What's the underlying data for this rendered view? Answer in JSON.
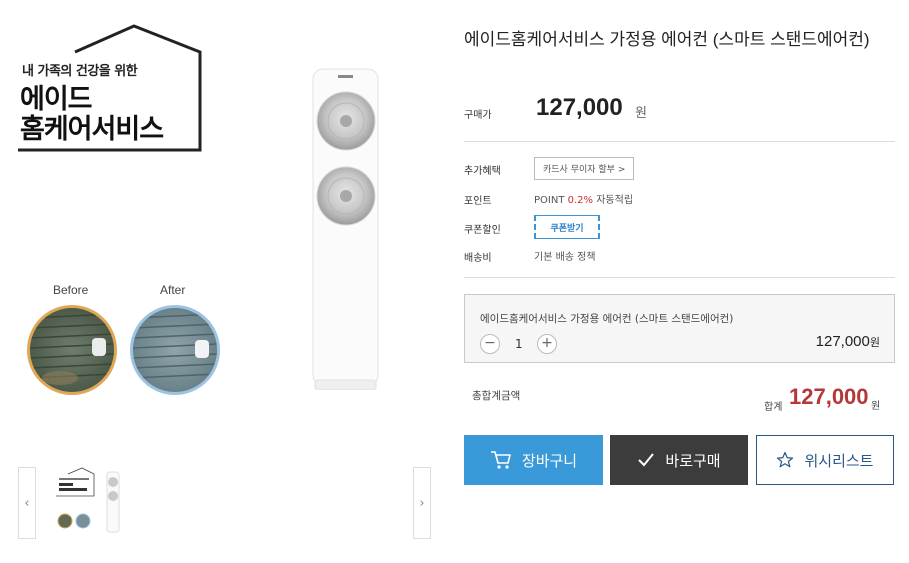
{
  "product": {
    "title": "에이드홈케어서비스 가정용 에어컨 (스마트 스탠드에어컨)",
    "brand_tagline": "내 가족의 건강을 위한",
    "brand_name_line1": "에이드",
    "brand_name_line2": "홈케어서비스",
    "compare_before": "Before",
    "compare_after": "After"
  },
  "price": {
    "label": "구매가",
    "value": "127,000",
    "unit": "원"
  },
  "info": {
    "benefit_label": "추가혜택",
    "benefit_button": "카드사 무이자 할부 >",
    "point_label": "포인트",
    "point_prefix": "POINT",
    "point_percent": "0.2%",
    "point_suffix": "자동적립",
    "coupon_label": "쿠폰할인",
    "coupon_button": "쿠폰받기",
    "shipping_label": "배송비",
    "shipping_value": "기본 배송 정책"
  },
  "option": {
    "name": "에이드홈케어서비스 가정용 에어컨 (스마트 스탠드에어컨)",
    "minus": "−",
    "quantity": "1",
    "plus": "+",
    "price": "127,000",
    "unit": "원"
  },
  "total": {
    "label": "총합계금액",
    "sum_label": "합계",
    "value": "127,000",
    "unit": "원"
  },
  "buttons": {
    "cart": "장바구니",
    "buy": "바로구매",
    "wishlist": "위시리스트"
  },
  "thumbnails": {
    "prev": "‹",
    "next": "›"
  },
  "colors": {
    "cart_blue": "#3a9ad9",
    "buy_dark": "#3c3c3c",
    "wish_navy": "#2b5785",
    "total_red": "#b4373a",
    "coupon_blue": "#3a95d5"
  }
}
